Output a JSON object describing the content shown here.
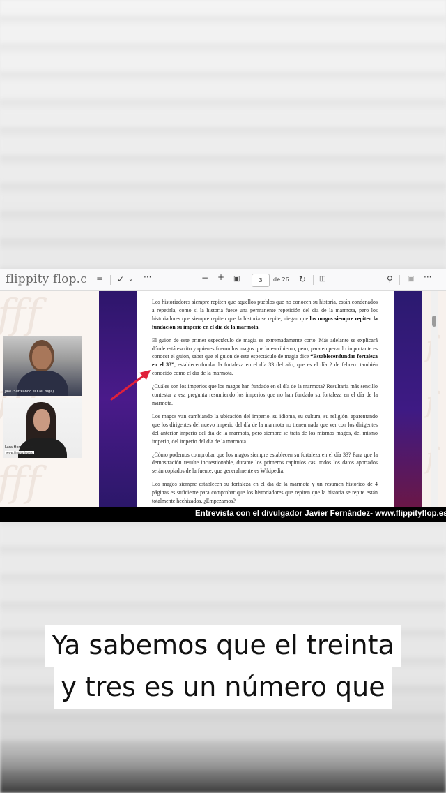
{
  "toolbar": {
    "logo": "flippity flop.c",
    "page_number": "3",
    "page_total": "de 26"
  },
  "participants": [
    {
      "name": "Javi (Surfeando el Kali Yuga)"
    },
    {
      "name": "Lara Hernández",
      "badge": "www.flippityflop.es"
    }
  ],
  "document": {
    "p1_a": "Los historiadores siempre repiten que aquellos pueblos que no conocen su historia, están condenados a repetirla, como si la historia fuese una permanente repetición del día de la marmota, pero los historiadores que siempre repiten que la historia se repite, niegan que ",
    "p1_b": "los magos siempre repiten la fundación su imperio en el día de la marmota",
    "p1_c": ".",
    "p2_a": "El guion de este primer espectáculo de magia es extremadamente corto. Más adelante se explicará dónde está escrito y quienes fueron los magos que lo escribieron, pero, para empezar lo importante es conocer el guion, saber que el guion de este espectáculo de magia dice ",
    "p2_b": "“Establecer/fundar fortaleza en el 33”",
    "p2_c": ", establecer/fundar la fortaleza en el día 33 del año, que es el día 2 de febrero también conocido como el día de la marmota.",
    "p3": "¿Cuáles son los imperios que los magos han fundado en el día de la marmota? Resultaría más sencillo contestar a esa pregunta resumiendo los imperios que no han fundado su fortaleza en el día de la marmota.",
    "p4": "Los magos van cambiando la ubicación del imperio, su idioma, su cultura, su religión, aparentando que los dirigentes del nuevo imperio del día de la marmota no tienen nada que ver con los dirigentes del anterior imperio del día de la marmota, pero siempre se trata de los mismos magos, del mismo imperio, del imperio del día de la marmota.",
    "p5": "¿Cómo podemos comprobar que los magos siempre establecen su fortaleza en el día 33? Para que la demostración resulte incuestionable, durante los primeros capítulos casi todos los datos aportados serán copiados de la fuente, que generalmente es Wikipedia.",
    "p6": "Los magos siempre establecen su fortaleza en el día de la marmota y un resumen histórico de 4 páginas es suficiente para comprobar que los historiadores que repiten que la historia se repite están totalmente hechizados, ¿Empezamos?"
  },
  "caption_bar": "Entrevista con el divulgador Javier Fernández- www.flippityflop.es",
  "subtitles": [
    "Ya sabemos que el treinta",
    "y tres es un número que"
  ],
  "colors": {
    "arrow": "#e0203a",
    "doc_border": "#3a1a80"
  }
}
